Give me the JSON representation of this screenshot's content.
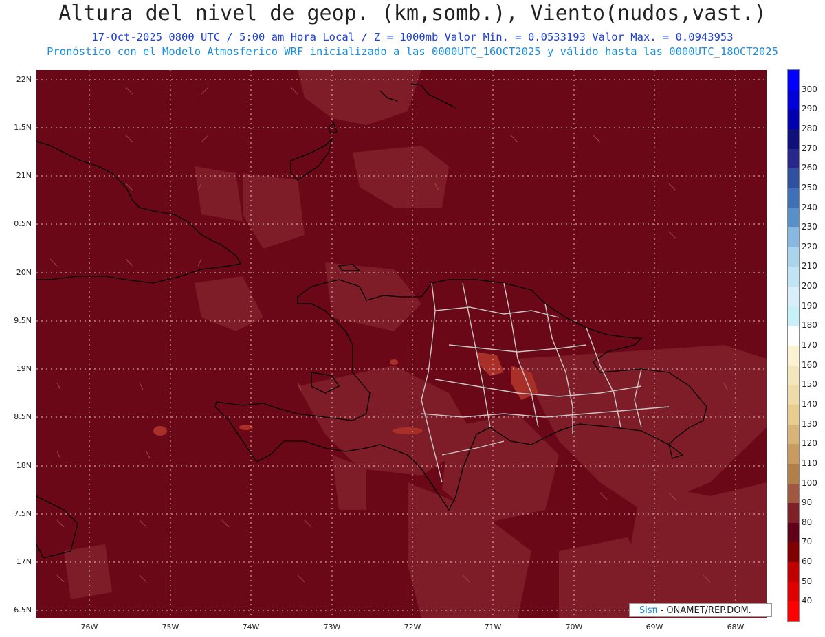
{
  "header": {
    "title": "Altura del nivel de geop. (km,somb.), Viento(nudos,vast.)",
    "line1": "17-Oct-2025  0800 UTC / 5:00 am Hora Local / Z = 1000mb Valor Min. = 0.0533193  Valor Max. = 0.0943953",
    "line2": "Pronóstico con el Modelo Atmosferico WRF inicializado a las 0000UTC_16OCT2025 y válido hasta las  0000UTC_18OCT2025"
  },
  "axes": {
    "lat_labels": [
      "22N",
      "1.5N",
      "21N",
      "0.5N",
      "20N",
      "9.5N",
      "19N",
      "8.5N",
      "18N",
      "7.5N",
      "17N",
      "6.5N"
    ],
    "lon_labels": [
      "76W",
      "75W",
      "74W",
      "73W",
      "72W",
      "71W",
      "70W",
      "69W",
      "68W"
    ]
  },
  "colorbar": {
    "labels": [
      "300",
      "290",
      "280",
      "270",
      "260",
      "250",
      "240",
      "230",
      "220",
      "210",
      "200",
      "190",
      "180",
      "170",
      "160",
      "150",
      "140",
      "130",
      "120",
      "110",
      "100",
      "90",
      "80",
      "70",
      "60",
      "50",
      "40"
    ],
    "colors": [
      "#0000ff",
      "#0000d8",
      "#0000b0",
      "#10107a",
      "#28288a",
      "#3050a0",
      "#4070b8",
      "#5890c8",
      "#88b8e0",
      "#a8d4ec",
      "#c0e4f4",
      "#d8eef8",
      "#c8f0f8",
      "#ffffff",
      "#faf2d0",
      "#f4e6bc",
      "#eedca8",
      "#e8cc90",
      "#d8b478",
      "#c89c60",
      "#b08048",
      "#a05840",
      "#802028",
      "#600018",
      "#800000",
      "#c00000",
      "#e00000",
      "#ff0000"
    ]
  },
  "map": {
    "background_color": "#6a0818",
    "lighter_color": "#7e1c28",
    "highlight_color": "#a83028"
  },
  "credit": {
    "brand": "Sisπ",
    "text": " - ONAMET/REP.DOM."
  }
}
